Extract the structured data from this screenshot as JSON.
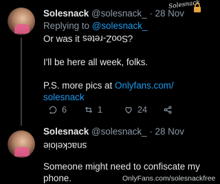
{
  "tweet1": {
    "name": "Solesnack",
    "handle": "@solesnack_",
    "separator": "·",
    "time": "28 Nov",
    "replying_prefix": "Replying to",
    "replying_to": "@solesnack_",
    "line1_prefix": "Or was it",
    "line1_flipped": "SooZ-retes",
    "line1_suffix": "?",
    "line2": "I'll be here all week, folks.",
    "line3_prefix": "P.S. more pics at",
    "line3_link_part1": "Onlyfans.com/",
    "line3_link_part2": "solesnack",
    "replies": "6",
    "retweets": "1",
    "likes": "24"
  },
  "tweet2": {
    "name": "Solesnack",
    "handle": "@solesnack_",
    "separator": "·",
    "time": "28 Nov",
    "flipped_word": "snackeloie",
    "line1": "Someone might need to confiscate my",
    "line2": "phone."
  },
  "watermark": {
    "signature": "Solesnack",
    "site": "OnlyFans.com/solesnackfree"
  },
  "icons": {
    "reply": "reply-icon",
    "retweet": "retweet-icon",
    "like": "heart-icon",
    "share": "share-icon"
  }
}
